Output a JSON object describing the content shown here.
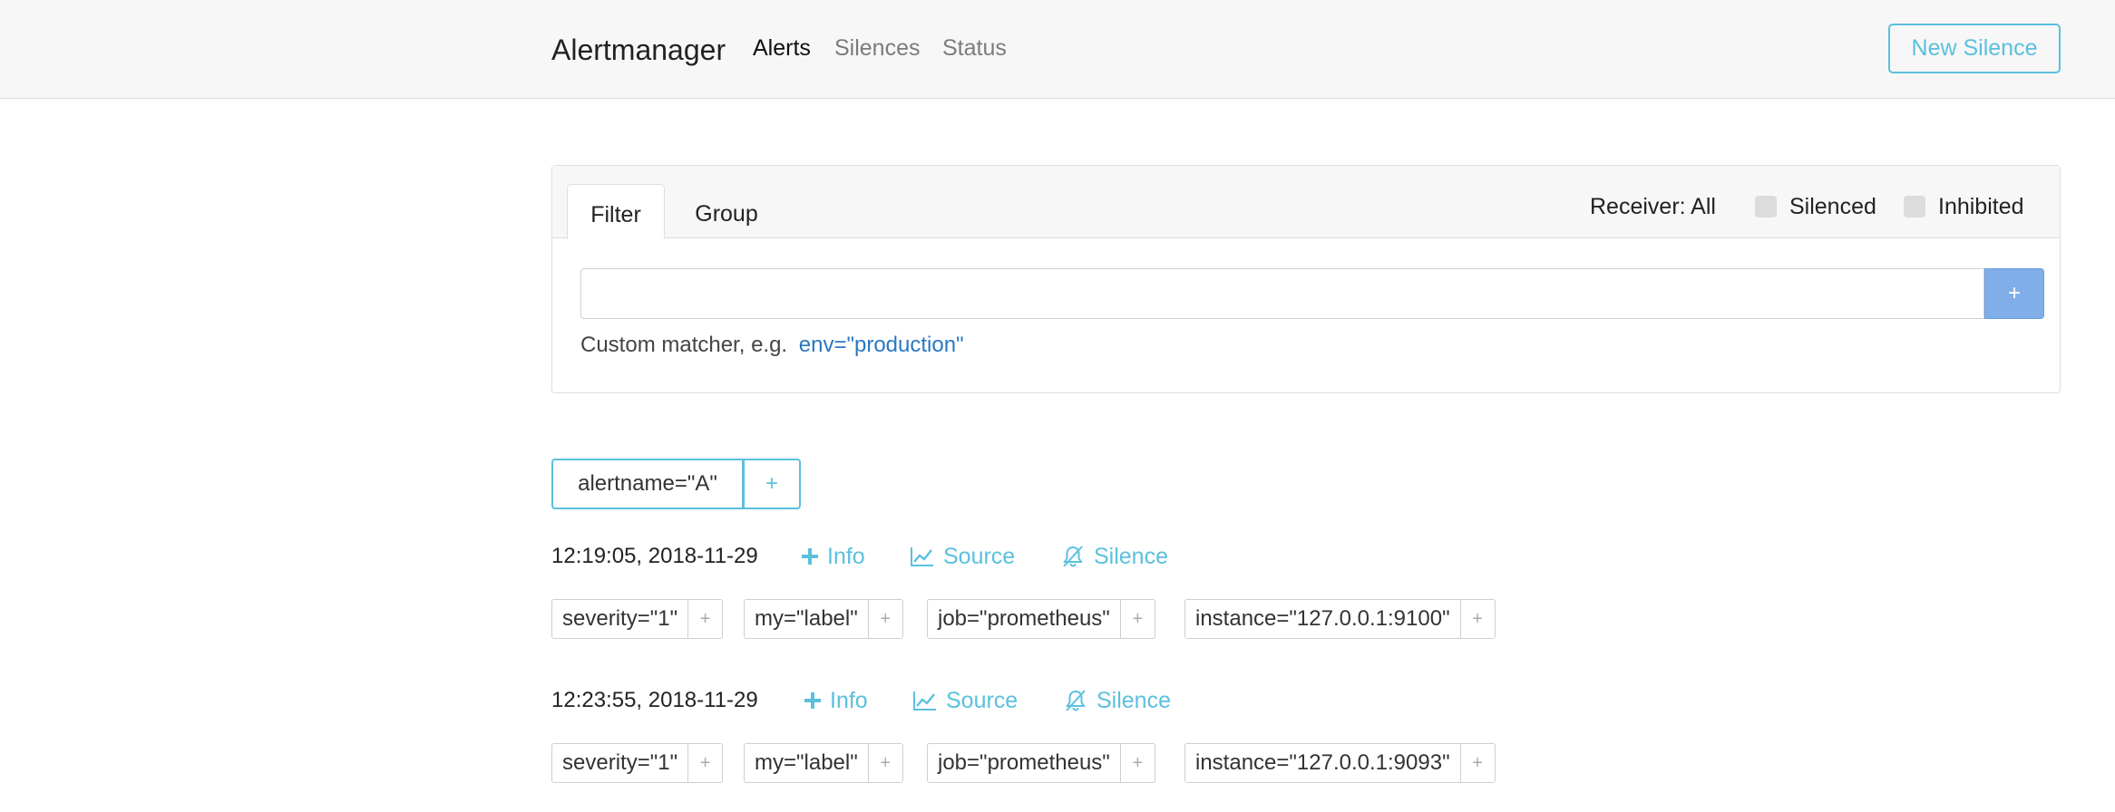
{
  "navbar": {
    "brand": "Alertmanager",
    "links": [
      {
        "label": "Alerts",
        "active": true
      },
      {
        "label": "Silences",
        "active": false
      },
      {
        "label": "Status",
        "active": false
      }
    ],
    "new_silence_label": "New Silence"
  },
  "filter_card": {
    "tabs": [
      {
        "label": "Filter",
        "active": true
      },
      {
        "label": "Group",
        "active": false
      }
    ],
    "receiver_label": "Receiver: All",
    "silenced_label": "Silenced",
    "inhibited_label": "Inhibited",
    "input_value": "",
    "add_label": "+",
    "hint_text": "Custom matcher, e.g.",
    "hint_example": "env=\"production\""
  },
  "group": {
    "label": "alertname=\"A\"",
    "plus": "+"
  },
  "actions": {
    "info": "Info",
    "source": "Source",
    "silence": "Silence"
  },
  "alerts": [
    {
      "time": "12:19:05, 2018-11-29",
      "labels": [
        "severity=\"1\"",
        "my=\"label\"",
        "job=\"prometheus\"",
        "instance=\"127.0.0.1:9100\""
      ]
    },
    {
      "time": "12:23:55, 2018-11-29",
      "labels": [
        "severity=\"1\"",
        "my=\"label\"",
        "job=\"prometheus\"",
        "instance=\"127.0.0.1:9093\""
      ]
    }
  ],
  "colors": {
    "accent": "#5bc0de",
    "primary_btn": "#7faee8",
    "link_blue": "#2a78c4"
  }
}
